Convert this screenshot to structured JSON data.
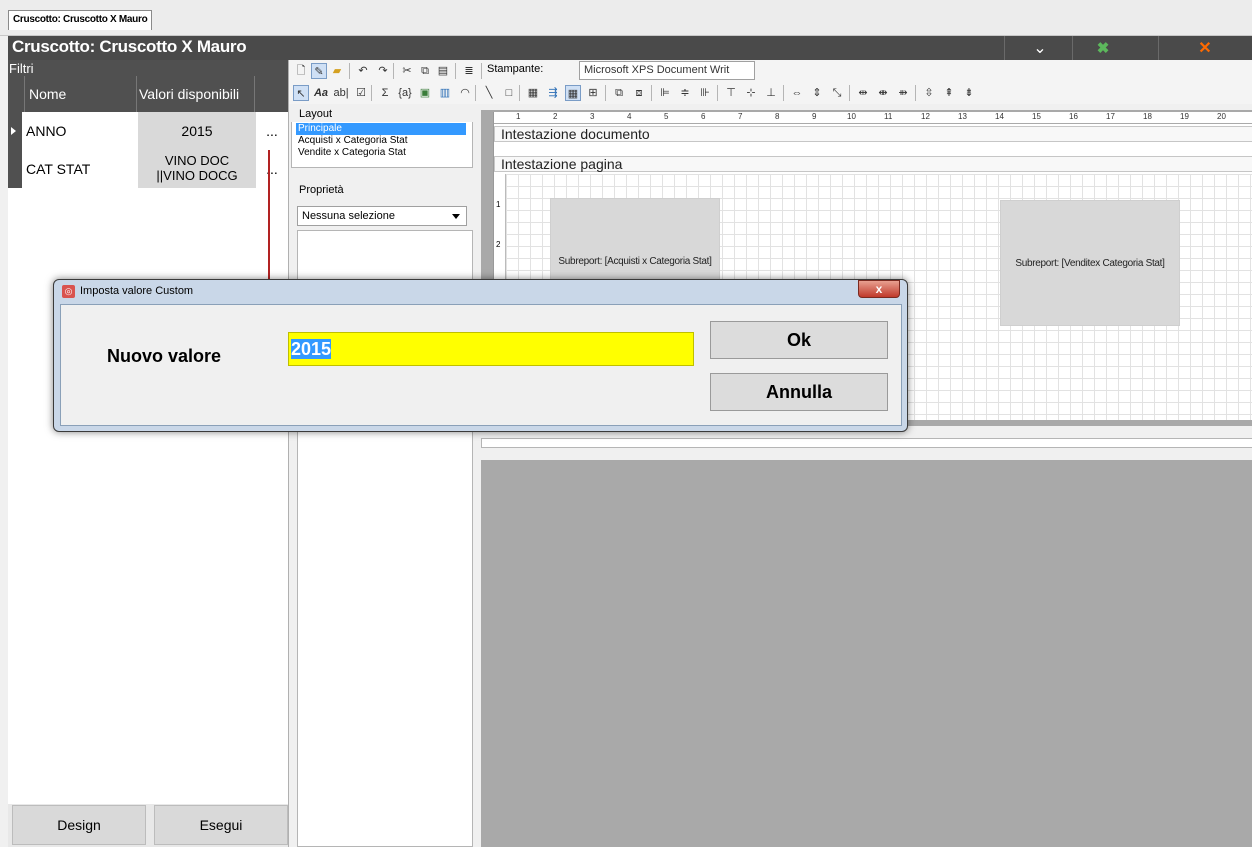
{
  "tab": {
    "label": "Cruscotto: Cruscotto X Mauro"
  },
  "titlebar": {
    "title": "Cruscotto: Cruscotto X Mauro",
    "chevron": "⌄",
    "excel": "✖",
    "close": "✕"
  },
  "filters": {
    "section_label": "Filtri",
    "headers": {
      "name": "Nome",
      "values": "Valori disponibili"
    },
    "rows": [
      {
        "name": "ANNO",
        "value": "2015",
        "more": "...",
        "line2": ""
      },
      {
        "name": "CAT STAT",
        "value": "VINO DOC",
        "line2": "||VINO DOCG",
        "more": "..."
      }
    ],
    "design_button": "Design",
    "run_button": "Esegui"
  },
  "designer": {
    "printer_label": "Stampante:",
    "printer_value": "Microsoft XPS Document Writ",
    "layout_title": "Layout",
    "layout_items": [
      "Principale",
      "Acquisti x Categoria Stat",
      "Vendite x Categoria Stat"
    ],
    "properties_title": "Proprietà",
    "properties_select": "Nessuna selezione",
    "band_doc_header": "Intestazione documento",
    "band_page_header": "Intestazione pagina",
    "subreport1": "Subreport: [Acquisti x Categoria Stat]",
    "subreport2": "Subreport: [Venditex Categoria Stat]",
    "ruler": [
      "1",
      "2",
      "3",
      "4",
      "5",
      "6",
      "7",
      "8",
      "9",
      "10",
      "11",
      "12",
      "13",
      "14",
      "15",
      "16",
      "17",
      "18",
      "19",
      "20"
    ],
    "vruler": [
      "1",
      "2"
    ]
  },
  "dialog": {
    "title": "Imposta valore Custom",
    "label": "Nuovo valore",
    "value": "2015",
    "ok": "Ok",
    "cancel": "Annulla",
    "close": "x"
  },
  "colors": {
    "accent_arrow": "#b22222",
    "highlight": "#ffff00",
    "selection": "#3399ff"
  }
}
